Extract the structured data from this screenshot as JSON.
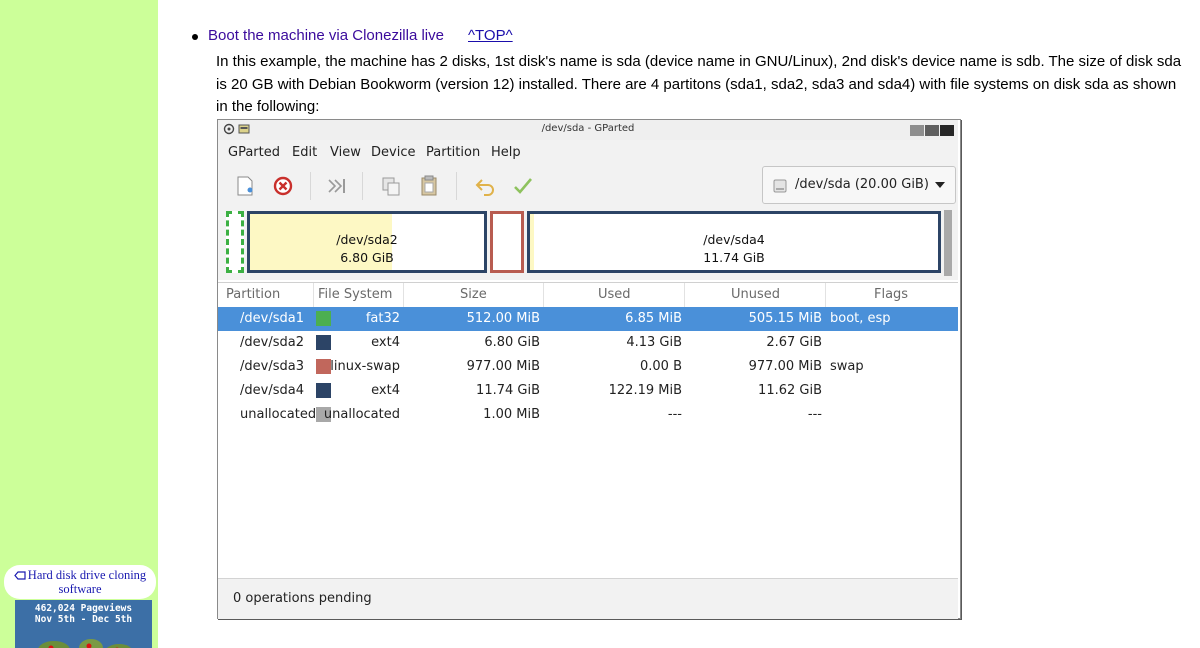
{
  "sidebar": {
    "tag_label": "Hard disk drive cloning software",
    "counter_line1": "462,024 Pageviews",
    "counter_line2": "Nov 5th - Dec 5th",
    "colors": {
      "background": "#ccff99",
      "counter": "#3c6fa6"
    }
  },
  "article": {
    "bullet_link": "Boot the machine via Clonezilla live",
    "top_link": "^TOP^",
    "paragraph": "In this example, the machine has 2 disks, 1st disk's name is sda (device name in GNU/Linux), 2nd disk's device name is sdb. The size of disk sda is 20 GB with Debian Bookworm (version 12) installed. There are 4 partitons (sda1, sda2, sda3 and sda4) with file systems on disk sda as shown in the following:"
  },
  "gparted": {
    "window_title": "/dev/sda - GParted",
    "menu": [
      "GParted",
      "Edit",
      "View",
      "Device",
      "Partition",
      "Help"
    ],
    "toolbar_icons": [
      "new-partition-icon",
      "delete-partition-icon",
      "resize-move-icon",
      "copy-icon",
      "paste-icon",
      "undo-icon",
      "apply-icon"
    ],
    "device_selector": "/dev/sda (20.00 GiB)",
    "disk_map": [
      {
        "name": "",
        "size": "",
        "color": "#3cb043"
      },
      {
        "name": "/dev/sda2",
        "size": "6.80 GiB",
        "color": "#2c4466",
        "used_fraction": 0.607
      },
      {
        "name": "",
        "size": "",
        "color": "#b85c50"
      },
      {
        "name": "/dev/sda4",
        "size": "11.74 GiB",
        "color": "#2c4466",
        "used_fraction": 0.01
      }
    ],
    "columns": [
      "Partition",
      "File System",
      "Size",
      "Used",
      "Unused",
      "Flags"
    ],
    "rows": [
      {
        "partition": "/dev/sda1",
        "fs": "fat32",
        "fs_color": "#4caf50",
        "size": "512.00 MiB",
        "used": "6.85 MiB",
        "unused": "505.15 MiB",
        "flags": "boot, esp",
        "selected": true
      },
      {
        "partition": "/dev/sda2",
        "fs": "ext4",
        "fs_color": "#2c4466",
        "size": "6.80 GiB",
        "used": "4.13 GiB",
        "unused": "2.67 GiB",
        "flags": "",
        "selected": false
      },
      {
        "partition": "/dev/sda3",
        "fs": "linux-swap",
        "fs_color": "#c1675c",
        "size": "977.00 MiB",
        "used": "0.00 B",
        "unused": "977.00 MiB",
        "flags": "swap",
        "selected": false
      },
      {
        "partition": "/dev/sda4",
        "fs": "ext4",
        "fs_color": "#2c4466",
        "size": "11.74 GiB",
        "used": "122.19 MiB",
        "unused": "11.62 GiB",
        "flags": "",
        "selected": false
      },
      {
        "partition": "unallocated",
        "fs": "unallocated",
        "fs_color": "#a8a8a8",
        "size": "1.00 MiB",
        "used": "---",
        "unused": "---",
        "flags": "",
        "selected": false
      }
    ],
    "status": "0 operations pending",
    "colors": {
      "selection": "#4a90d9",
      "used_fill": "#fdf8c4"
    }
  }
}
